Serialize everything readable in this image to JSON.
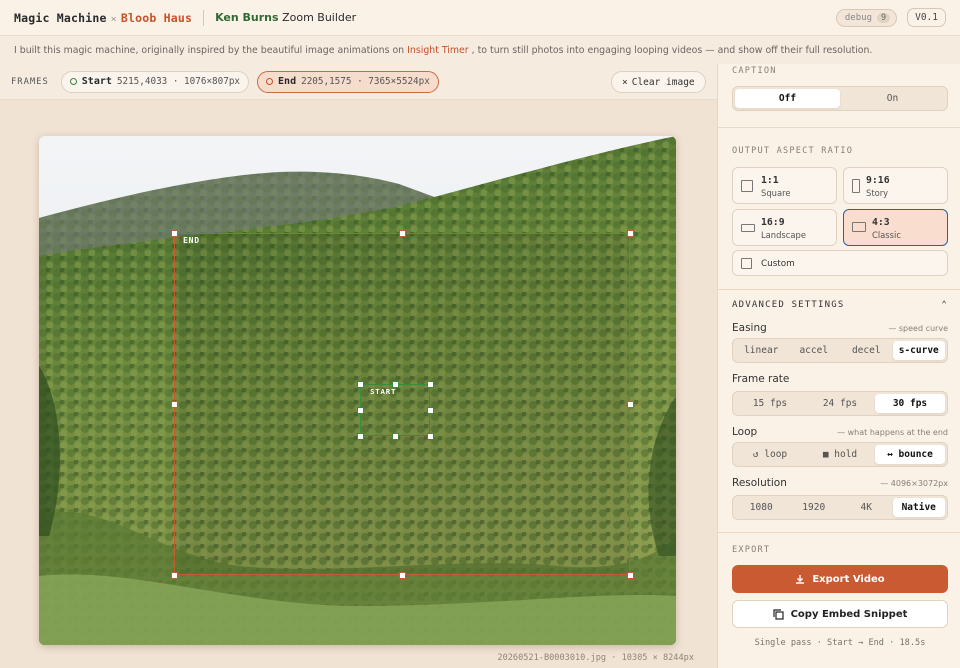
{
  "header": {
    "brand_a": "Magic Machine",
    "brand_x": "×",
    "brand_b": "Bloob Haus",
    "tool_bold": "Ken Burns",
    "tool_rest": " Zoom Builder",
    "debug_label": "debug",
    "debug_count": "9",
    "version": "V0.1"
  },
  "info": {
    "pre": "I built this magic machine, originally inspired by the beautiful image animations on",
    "link": "Insight Timer",
    "post": ", to turn still photos into engaging looping videos — and show off their full resolution."
  },
  "frames": {
    "label": "FRAMES",
    "start": {
      "name": "Start",
      "detail": "5215,4033 · 1076×807px"
    },
    "end": {
      "name": "End",
      "detail": "2205,1575 · 7365×5524px"
    },
    "clear": "Clear image"
  },
  "canvas": {
    "end_label": "END",
    "start_label": "START",
    "file_info": "20260521-B0003010.jpg · 10305 × 8244px"
  },
  "panel": {
    "caption": {
      "label": "CAPTION",
      "options": [
        "Off",
        "On"
      ],
      "selected": "Off"
    },
    "aspect": {
      "label": "OUTPUT ASPECT RATIO",
      "options": [
        {
          "ratio": "1:1",
          "name": "Square"
        },
        {
          "ratio": "9:16",
          "name": "Story"
        },
        {
          "ratio": "16:9",
          "name": "Landscape"
        },
        {
          "ratio": "4:3",
          "name": "Classic"
        }
      ],
      "custom": "Custom",
      "selected": "4:3"
    },
    "advanced": {
      "label": "ADVANCED SETTINGS",
      "easing": {
        "label": "Easing",
        "hint": "— speed curve",
        "options": [
          "linear",
          "accel",
          "decel",
          "s-curve"
        ],
        "selected": "s-curve"
      },
      "framerate": {
        "label": "Frame rate",
        "options": [
          "15 fps",
          "24 fps",
          "30 fps"
        ],
        "selected": "30 fps"
      },
      "loop": {
        "label": "Loop",
        "hint": "— what happens at the end",
        "options": [
          "↺ loop",
          "■ hold",
          "↔ bounce"
        ],
        "selected": "↔ bounce"
      },
      "resolution": {
        "label": "Resolution",
        "hint": "— 4096×3072px",
        "options": [
          "1080",
          "1920",
          "4K",
          "Native"
        ],
        "selected": "Native"
      }
    },
    "export": {
      "label": "EXPORT",
      "export_btn": "Export Video",
      "embed_btn": "Copy Embed Snippet",
      "footer": "Single pass · Start → End · 18.5s"
    }
  },
  "colors": {
    "accent": "#c95a31",
    "end_frame": "#c85a2e",
    "start_frame": "#3a8a3c",
    "selected_ratio_border": "#2d5fad"
  }
}
